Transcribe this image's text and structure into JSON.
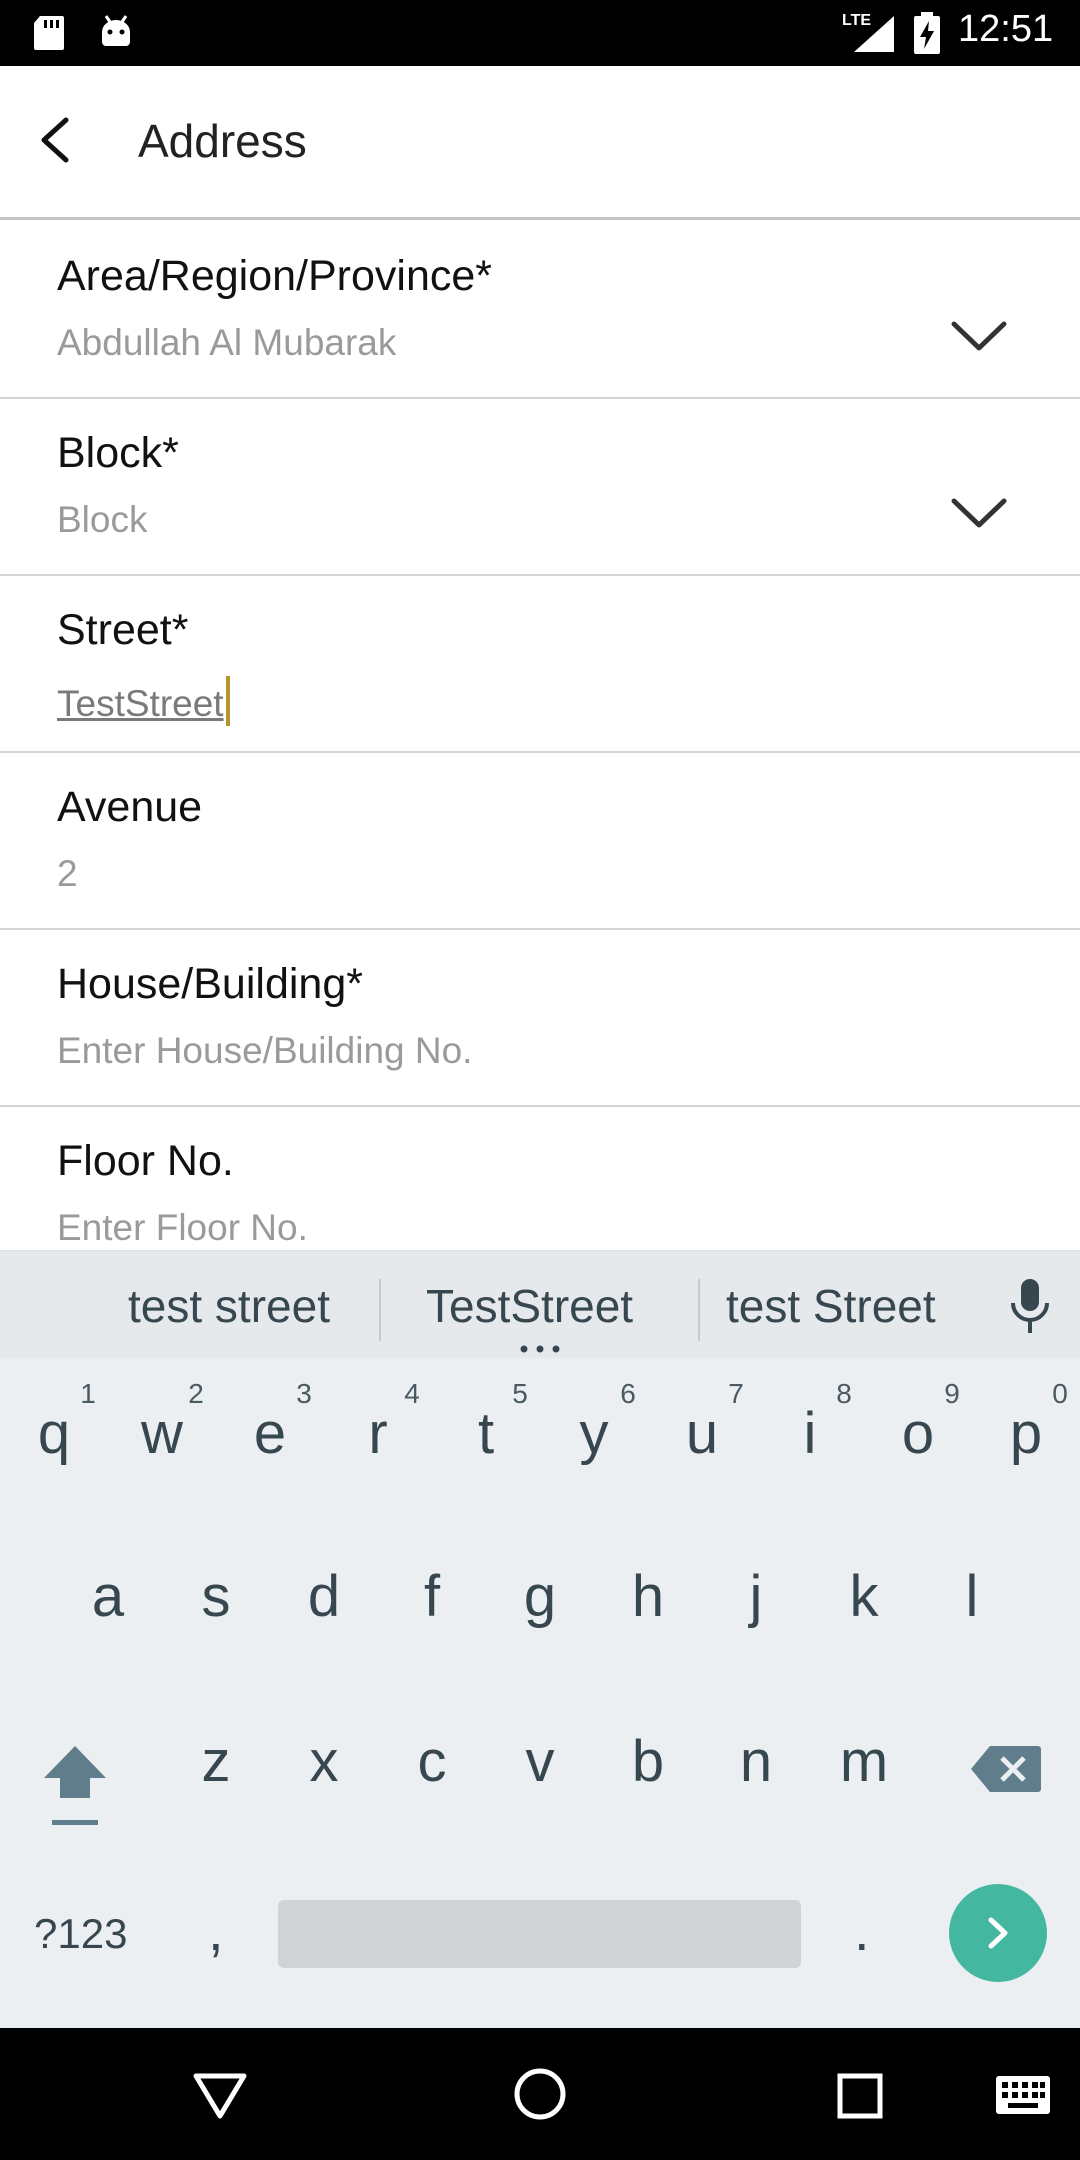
{
  "status_bar": {
    "time": "12:51",
    "network": "LTE"
  },
  "app_bar": {
    "title": "Address"
  },
  "form": {
    "fields": [
      {
        "label": "Area/Region/Province*",
        "value": "Abdullah Al Mubarak"
      },
      {
        "label": "Block*",
        "value": "Block"
      },
      {
        "label": "Street*",
        "value": "TestStreet"
      },
      {
        "label": "Avenue",
        "value": "2"
      },
      {
        "label": "House/Building*",
        "value": "Enter House/Building No."
      },
      {
        "label": "Floor No.",
        "value": "Enter Floor No."
      }
    ]
  },
  "keyboard": {
    "suggestions": [
      "test street",
      "TestStreet",
      "test Street"
    ],
    "row1": [
      "q",
      "w",
      "e",
      "r",
      "t",
      "y",
      "u",
      "i",
      "o",
      "p"
    ],
    "row1_hints": [
      "1",
      "2",
      "3",
      "4",
      "5",
      "6",
      "7",
      "8",
      "9",
      "0"
    ],
    "row2": [
      "a",
      "s",
      "d",
      "f",
      "g",
      "h",
      "j",
      "k",
      "l"
    ],
    "row3": [
      "z",
      "x",
      "c",
      "v",
      "b",
      "n",
      "m"
    ],
    "symbols_label": "?123",
    "comma": ",",
    "period": "."
  },
  "colors": {
    "accent": "#44b7a1",
    "cursor": "#b8952c",
    "keyboard_bg": "#eceff1"
  }
}
